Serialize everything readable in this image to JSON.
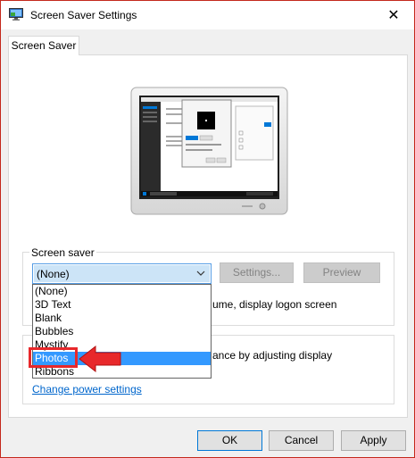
{
  "window": {
    "title": "Screen Saver Settings",
    "close_glyph": "✕",
    "border_color": "#c4281c"
  },
  "tabs": [
    {
      "label": "Screen Saver",
      "active": true
    }
  ],
  "screen_saver": {
    "group_label": "Screen saver",
    "selected": "(None)",
    "settings_label": "Settings...",
    "preview_label": "Preview",
    "resume_text": "ume, display logon screen"
  },
  "dropdown": {
    "options": [
      "(None)",
      "3D Text",
      "Blank",
      "Bubbles",
      "Mystify",
      "Photos",
      "Ribbons"
    ],
    "highlighted": "Photos",
    "highlight_color": "#3399ff"
  },
  "power": {
    "text": "ance by adjusting display",
    "link": "Change power settings"
  },
  "footer": {
    "ok": "OK",
    "cancel": "Cancel",
    "apply": "Apply"
  },
  "annotation": {
    "highlight_color": "#e8282b",
    "arrow_icon": "left-arrow-icon"
  }
}
